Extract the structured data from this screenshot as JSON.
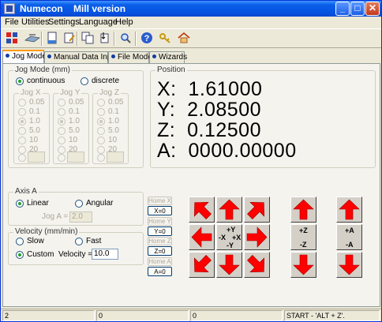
{
  "window": {
    "title": "Numecon    Mill version",
    "min_glyph": "_",
    "max_glyph": "□",
    "close_glyph": "✕"
  },
  "menu": [
    "File",
    "Utilities",
    "Settings",
    "Language",
    "Help"
  ],
  "toolbar_icons": [
    "grid-icon",
    "mill-icon",
    "open-file-icon",
    "edit-file-icon",
    "copy-icon",
    "tool-change-icon",
    "zoom-icon",
    "help-icon",
    "key-icon",
    "home-icon"
  ],
  "tabs": [
    "Jog Mode",
    "Manual Data Input",
    "File Mode",
    "Wizards"
  ],
  "jog_mode": {
    "label": "Jog Mode  (mm)",
    "continuous": "continuous",
    "discrete": "discrete",
    "groups": [
      {
        "label": "Jog X",
        "options": [
          "0.05",
          "0.1",
          "1.0",
          "5.0",
          "10",
          "20"
        ],
        "selected": 2,
        "value": ""
      },
      {
        "label": "Jog Y",
        "options": [
          "0.05",
          "0.1",
          "1.0",
          "5.0",
          "10",
          "20"
        ],
        "selected": 2,
        "value": ""
      },
      {
        "label": "Jog Z",
        "options": [
          "0.05",
          "0.1",
          "1.0",
          "5.0",
          "10",
          "20"
        ],
        "selected": 2,
        "value": ""
      }
    ]
  },
  "position": {
    "label": "Position",
    "lines": [
      "X:  1.61000",
      "Y:  2.08500",
      "Z:  0.12500",
      "A:  0000.00000"
    ]
  },
  "axis_a": {
    "label": "Axis A",
    "linear": "Linear",
    "angular": "Angular",
    "jog_label": "Jog A =",
    "jog_value": "2.0"
  },
  "velocity": {
    "label": "Velocity  (mm/min)",
    "slow": "Slow",
    "fast": "Fast",
    "custom": "Custom",
    "field_label": "Velocity =",
    "value": "10.0"
  },
  "home_buttons": [
    {
      "home": "Home X",
      "zero": "X=0"
    },
    {
      "home": "Home Y",
      "zero": "Y=0"
    },
    {
      "home": "Home Z",
      "zero": "Z=0"
    },
    {
      "home": "Home A",
      "zero": "A=0"
    }
  ],
  "jog_pad": {
    "center_py": "+Y",
    "center_mx": "-X",
    "center_px": "+X",
    "center_my": "-Y",
    "z_plus": "+Z",
    "z_minus": "-Z",
    "a_plus": "+A",
    "a_minus": "-A",
    "arrow_color": "#ff0000"
  },
  "status": [
    "2",
    "0",
    "0",
    "START - 'ALT + Z'."
  ]
}
